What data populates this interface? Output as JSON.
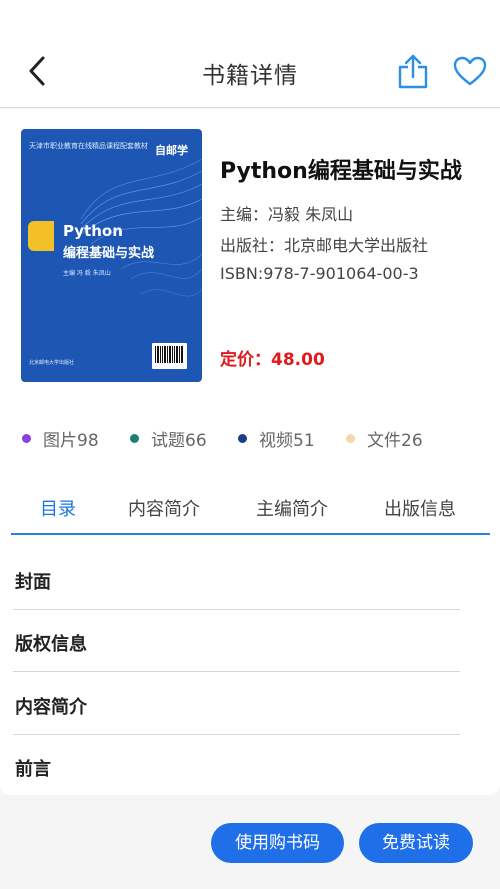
{
  "header": {
    "title": "书籍详情"
  },
  "book": {
    "title": "Python编程基础与实战",
    "editor": "主编：冯毅 朱凤山",
    "publisher": "出版社：北京邮电大学出版社",
    "isbn": "ISBN:978-7-901064-00-3",
    "price": "定价：48.00"
  },
  "cover": {
    "top_text": "天津市职业教育在线精品课程配套教材",
    "brand": "自邮学",
    "title_line1": "Python",
    "title_line2": "编程基础与实战",
    "authors": "主编  冯  毅  朱凤山",
    "publisher": "北京邮电大学出版社"
  },
  "stats": [
    {
      "label": "图片98",
      "color": "#8b3fe0"
    },
    {
      "label": "试题66",
      "color": "#1f7f78"
    },
    {
      "label": "视频51",
      "color": "#1a3f8a"
    },
    {
      "label": "文件26",
      "color": "#f6d6ab"
    }
  ],
  "tabs": [
    {
      "label": "目录",
      "active": true
    },
    {
      "label": "内容简介",
      "active": false
    },
    {
      "label": "主编简介",
      "active": false
    },
    {
      "label": "出版信息",
      "active": false
    }
  ],
  "toc": [
    {
      "label": "封面"
    },
    {
      "label": "版权信息"
    },
    {
      "label": "内容简介"
    },
    {
      "label": "前言"
    }
  ],
  "actions": {
    "redeem_label": "使用购书码",
    "trial_label": "免费试读"
  },
  "colors": {
    "accent": "#1f6fe8",
    "price": "#e1191b",
    "cover": "#1d57b3"
  }
}
